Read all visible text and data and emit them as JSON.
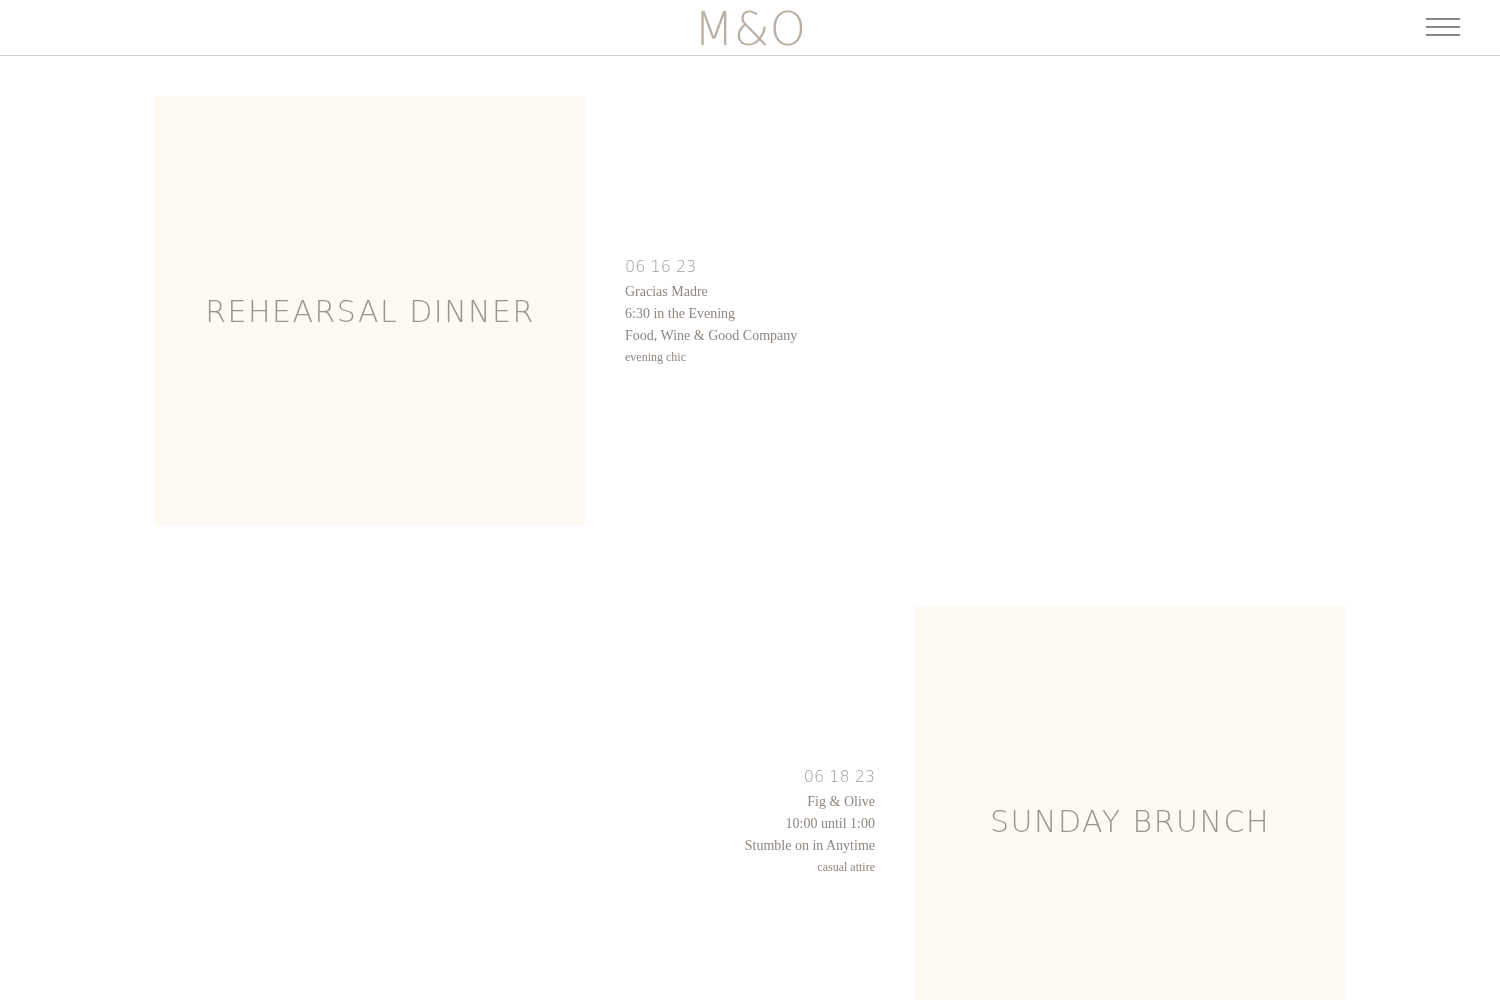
{
  "header": {
    "logo": "M&O"
  },
  "events": [
    {
      "kind": "left",
      "title": "REHEARSAL DINNER",
      "date": "06 16 23",
      "venue": "Gracias Madre",
      "time": "6:30 in the Evening",
      "note": "Food, Wine & Good Company",
      "attire": "evening chic"
    },
    {
      "kind": "right",
      "title": "SUNDAY BRUNCH",
      "date": "06 18 23",
      "venue": "Fig & Olive",
      "time": "10:00 until 1:00",
      "note": "Stumble on in Anytime",
      "attire": "casual attire"
    }
  ]
}
